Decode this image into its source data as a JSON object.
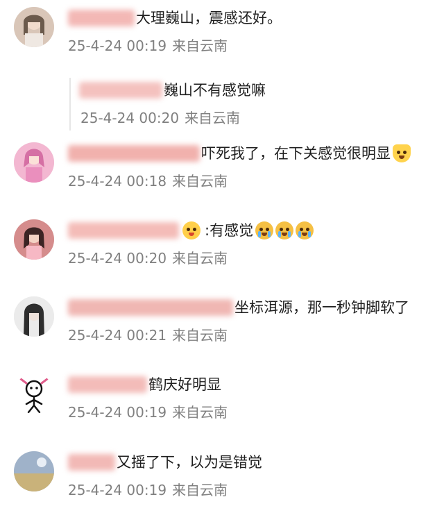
{
  "comments": [
    {
      "text": "大理巍山，震感还好。",
      "time": "25-4-24 00:19",
      "location": "来自云南",
      "username_blur_color": "#f3b8b5",
      "avatar_colors": [
        "#d9c6b8",
        "#6b5a4c"
      ],
      "reply": {
        "text": "巍山不有感觉嘛",
        "time": "25-4-24 00:20",
        "location": "来自云南",
        "username_blur_color": "#f4c1be"
      }
    },
    {
      "text": "吓死我了，在下关感觉很明显",
      "time": "25-4-24 00:18",
      "location": "来自云南",
      "username_blur_color": "#f1b1ad",
      "avatar_colors": [
        "#f3b7d1",
        "#d56fa4"
      ],
      "trailing_emoji": "cat-face-icon"
    },
    {
      "text": ":有感觉",
      "time": "25-4-24 00:20",
      "location": "来自云南",
      "username_blur_color": "#f4bcb8",
      "avatar_colors": [
        "#d58c8c",
        "#3c2424"
      ],
      "badge_emoji": "crown-face-icon",
      "trailing_emojis": [
        "crying-face-icon",
        "crying-face-icon",
        "crying-face-icon"
      ]
    },
    {
      "text": "坐标洱源，那一秒钟脚软了",
      "time": "25-4-24 00:21",
      "location": "来自云南",
      "username_blur_color": "#f0b7b3",
      "avatar_colors": [
        "#ebebeb",
        "#2e2e2e"
      ]
    },
    {
      "text": "鹤庆好明显",
      "time": "25-4-24 00:19",
      "location": "来自云南",
      "username_blur_color": "#f3bcb9",
      "avatar_colors": [
        "#ffffff",
        "#111111"
      ]
    },
    {
      "text": "又摇了下，以为是错觉",
      "time": "25-4-24 00:19",
      "location": "来自云南",
      "username_blur_color": "#f2b9b6",
      "avatar_colors": [
        "#9fb2c9",
        "#c9b27a"
      ]
    }
  ]
}
